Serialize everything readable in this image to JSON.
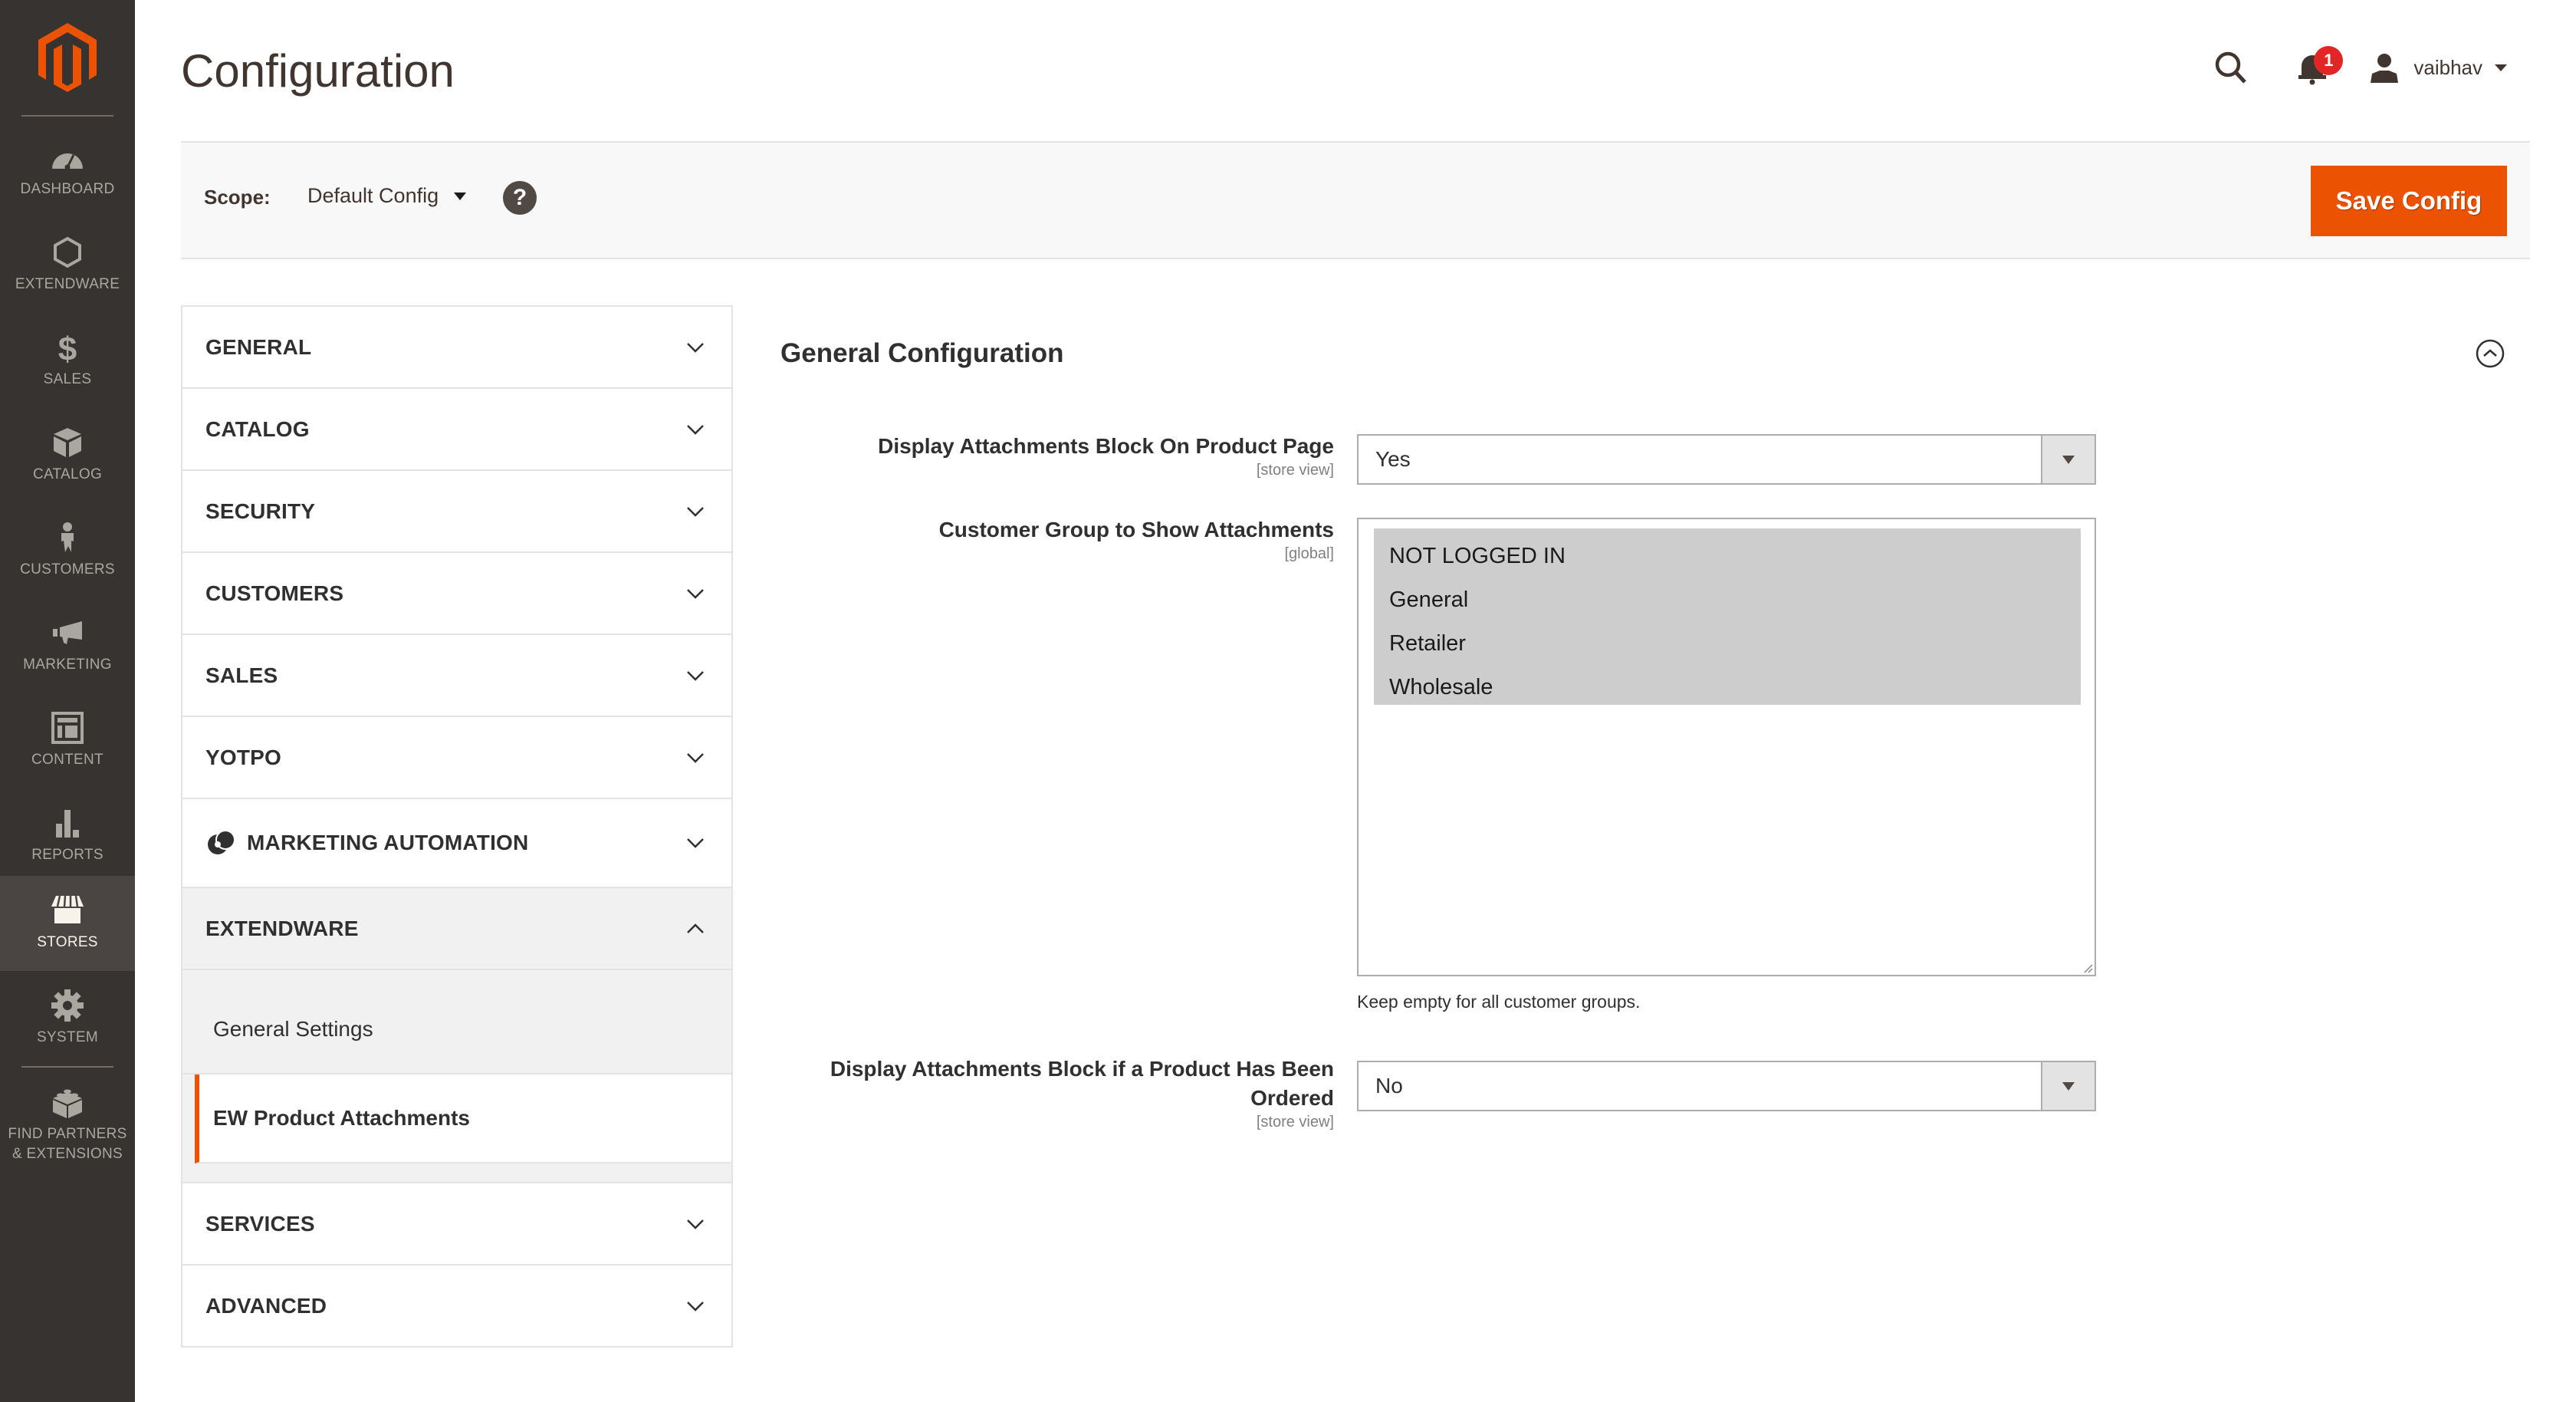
{
  "app": {
    "brand": "Magento",
    "accent_color": "#eb5202",
    "nav_bg_color": "#373330"
  },
  "admin_nav": {
    "items": [
      {
        "label": "DASHBOARD",
        "icon": "dashboard-icon"
      },
      {
        "label": "EXTENDWARE",
        "icon": "hexagon-icon"
      },
      {
        "label": "SALES",
        "icon": "dollar-icon"
      },
      {
        "label": "CATALOG",
        "icon": "box-icon"
      },
      {
        "label": "CUSTOMERS",
        "icon": "person-icon"
      },
      {
        "label": "MARKETING",
        "icon": "megaphone-icon"
      },
      {
        "label": "CONTENT",
        "icon": "layout-icon"
      },
      {
        "label": "REPORTS",
        "icon": "bar-chart-icon"
      },
      {
        "label": "STORES",
        "icon": "storefront-icon",
        "active": true
      },
      {
        "label": "SYSTEM",
        "icon": "gear-icon"
      },
      {
        "label": "FIND PARTNERS & EXTENSIONS",
        "icon": "lego-brick-icon"
      }
    ]
  },
  "header": {
    "title": "Configuration",
    "notifications_count": "1",
    "username": "vaibhav"
  },
  "scope_bar": {
    "label": "Scope:",
    "value": "Default Config",
    "help": "?",
    "save_label": "Save Config"
  },
  "config_menu": {
    "groups": [
      {
        "label": "GENERAL",
        "expanded": false
      },
      {
        "label": "CATALOG",
        "expanded": false
      },
      {
        "label": "SECURITY",
        "expanded": false
      },
      {
        "label": "CUSTOMERS",
        "expanded": false
      },
      {
        "label": "SALES",
        "expanded": false
      },
      {
        "label": "YOTPO",
        "expanded": false
      },
      {
        "label": "MARKETING AUTOMATION",
        "expanded": false
      },
      {
        "label": "EXTENDWARE",
        "expanded": true,
        "children": [
          {
            "label": "General Settings",
            "active": false
          },
          {
            "label": "EW Product Attachments",
            "active": true
          }
        ]
      },
      {
        "label": "SERVICES",
        "expanded": false
      },
      {
        "label": "ADVANCED",
        "expanded": false
      }
    ]
  },
  "section": {
    "title": "General Configuration",
    "fields": [
      {
        "label": "Display Attachments Block On Product Page",
        "scope": "[store view]",
        "type": "select",
        "value": "Yes"
      },
      {
        "label": "Customer Group to Show Attachments",
        "scope": "[global]",
        "type": "multiselect",
        "options": [
          "NOT LOGGED IN",
          "General",
          "Retailer",
          "Wholesale"
        ],
        "note": "Keep empty for all customer groups."
      },
      {
        "label_line1": "Display Attachments Block if a Product Has Been",
        "label_line2": "Ordered",
        "scope": "[store view]",
        "type": "select",
        "value": "No"
      }
    ]
  }
}
